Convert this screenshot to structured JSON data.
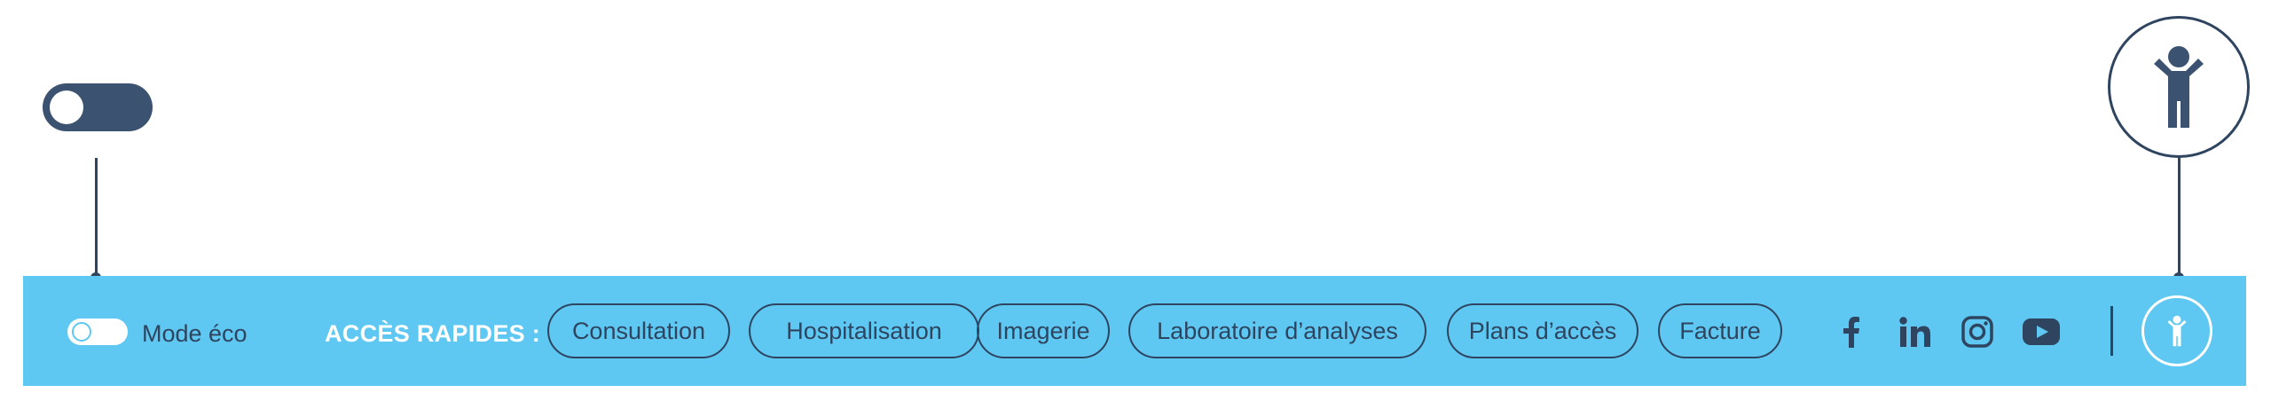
{
  "eco": {
    "label": "Mode éco",
    "enabled": false
  },
  "quick_access": {
    "label": "ACCÈS RAPIDES :",
    "items": [
      "Consultation",
      "Hospitalisation",
      "Imagerie",
      "Laboratoire d’analyses",
      "Plans d’accès",
      "Facture"
    ]
  },
  "social": [
    "facebook-icon",
    "linkedin-icon",
    "instagram-icon",
    "youtube-icon"
  ],
  "accessibility": {
    "icon": "accessibility-person-icon"
  },
  "colors": {
    "bar": "#5ec8f2",
    "navy": "#2e445f",
    "white": "#ffffff"
  }
}
